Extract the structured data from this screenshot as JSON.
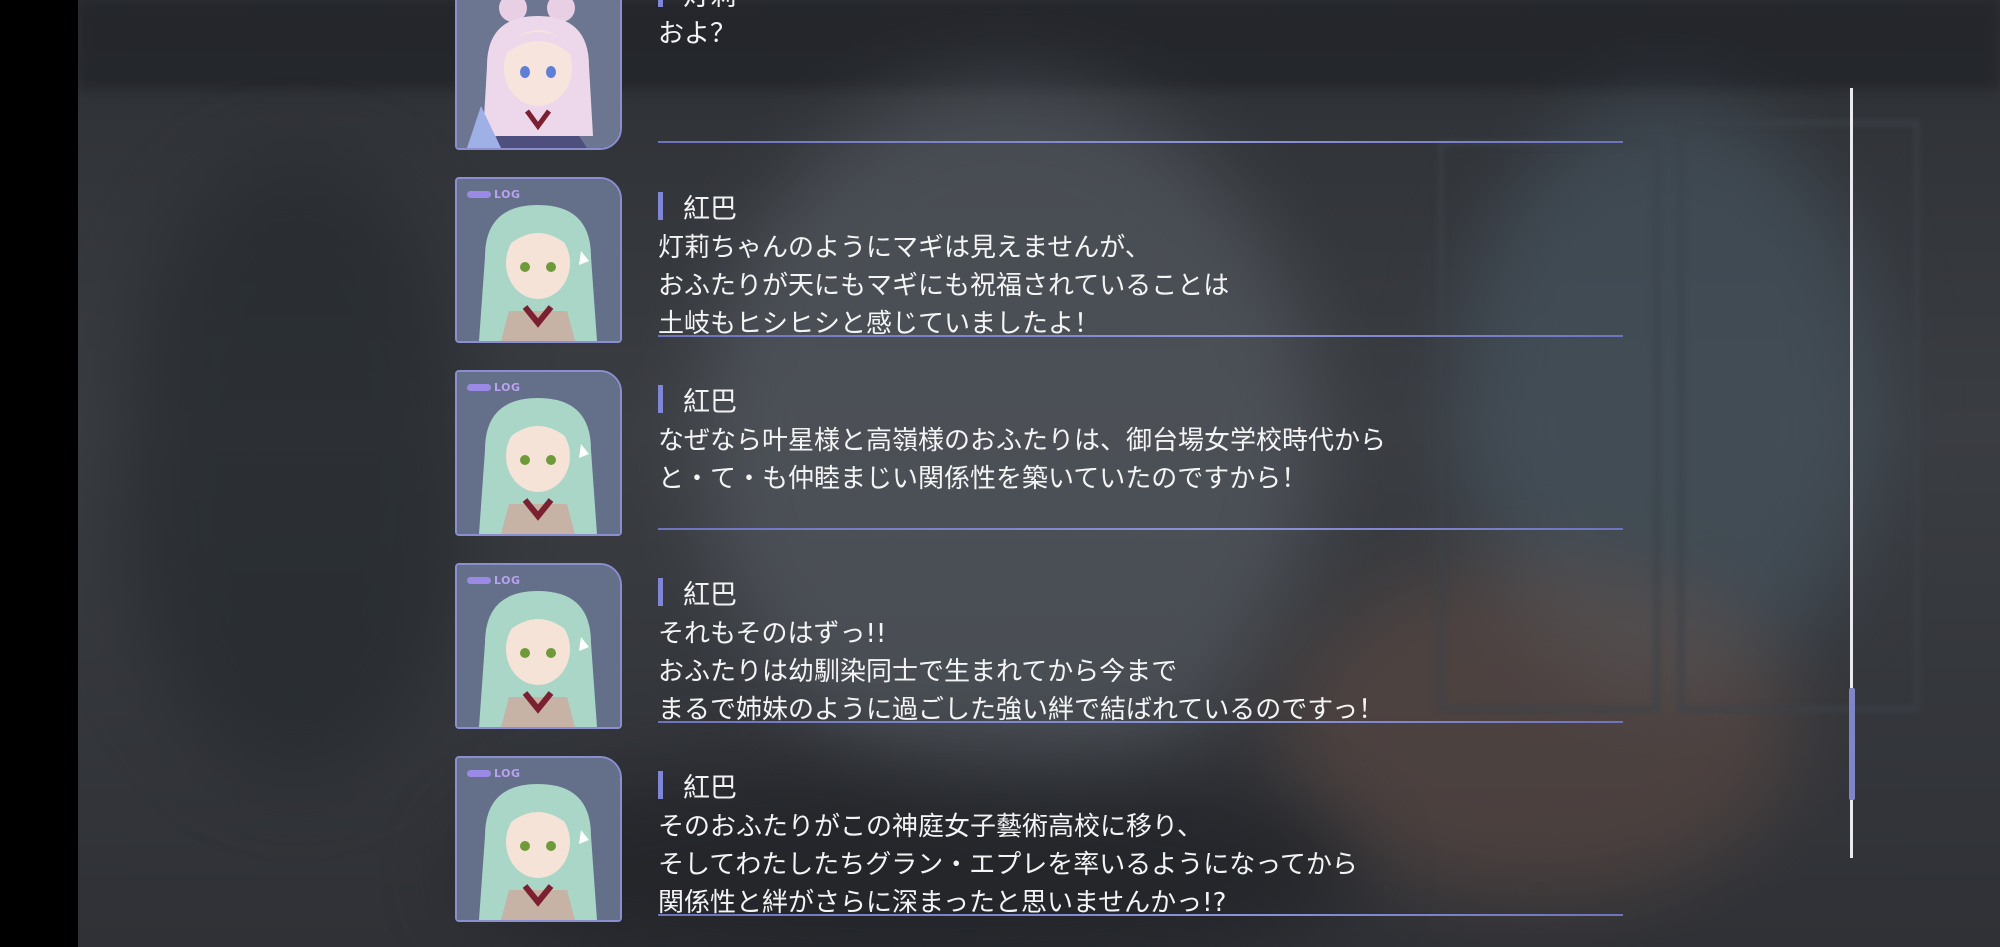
{
  "entries": [
    {
      "speaker": "灯莉",
      "character": "pink-haired-girl",
      "lines": [
        "およ？"
      ]
    },
    {
      "speaker": "紅巴",
      "character": "green-haired-girl",
      "log_tag": "LOG",
      "lines": [
        "灯莉ちゃんのようにマギは見えませんが、",
        "おふたりが天にもマギにも祝福されていることは",
        "土岐もヒシヒシと感じていましたよ！"
      ]
    },
    {
      "speaker": "紅巴",
      "character": "green-haired-girl",
      "log_tag": "LOG",
      "lines": [
        "なぜなら叶星様と高嶺様のおふたりは、御台場女学校時代から",
        "と・て・も仲睦まじい関係性を築いていたのですから！"
      ]
    },
    {
      "speaker": "紅巴",
      "character": "green-haired-girl",
      "log_tag": "LOG",
      "lines": [
        "それもそのはずっ!!",
        "おふたりは幼馴染同士で生まれてから今まで",
        "まるで姉妹のように過ごした強い絆で結ばれているのですっ！"
      ]
    },
    {
      "speaker": "紅巴",
      "character": "green-haired-girl",
      "log_tag": "LOG",
      "lines": [
        "そのおふたりがこの神庭女子藝術高校に移り、",
        "そしてわたしたちグラン・エプレを率いるようになってから",
        "関係性と絆がさらに深まったと思いませんかっ!?"
      ]
    }
  ],
  "scrollbar": {
    "position_fraction": 0.82
  },
  "colors": {
    "accent": "#7f86d8",
    "text": "#f4f4f4",
    "log_tag": "#b9a2f0"
  }
}
